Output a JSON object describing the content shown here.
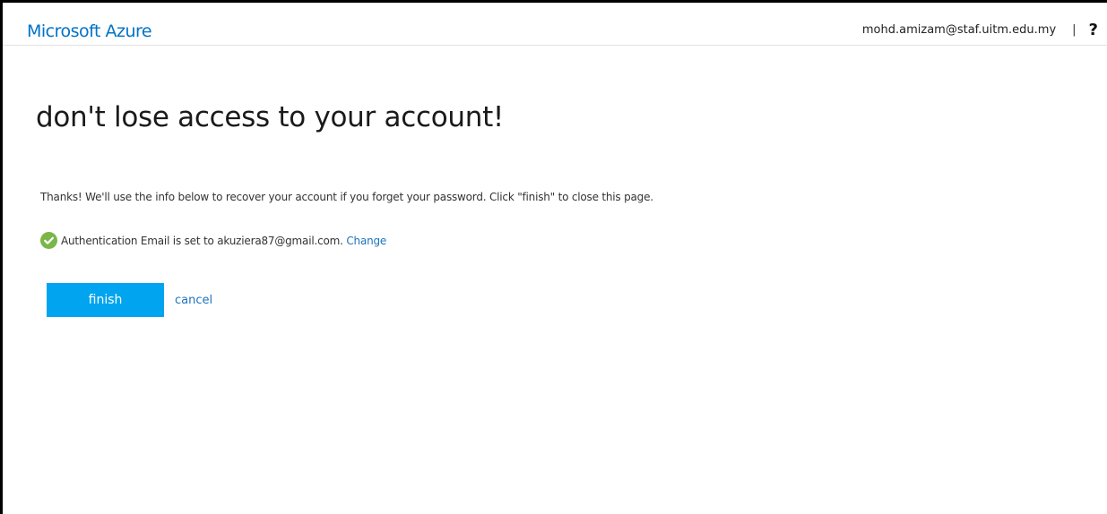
{
  "header": {
    "brand": "Microsoft Azure",
    "user_email": "mohd.amizam@staf.uitm.edu.my",
    "divider": "|",
    "help_symbol": "?"
  },
  "main": {
    "title": "don't lose access to your account!",
    "info_text": "Thanks! We'll use the info below to recover your account if you forget your password. Click \"finish\" to close this page.",
    "status": {
      "icon": "check-circle-icon",
      "text": "Authentication Email is set to akuziera87@gmail.com.",
      "change_label": "Change"
    },
    "actions": {
      "finish_label": "finish",
      "cancel_label": "cancel"
    }
  },
  "colors": {
    "brand": "#0072c6",
    "link": "#1e73be",
    "button": "#00a4ef",
    "success": "#7ab648"
  }
}
